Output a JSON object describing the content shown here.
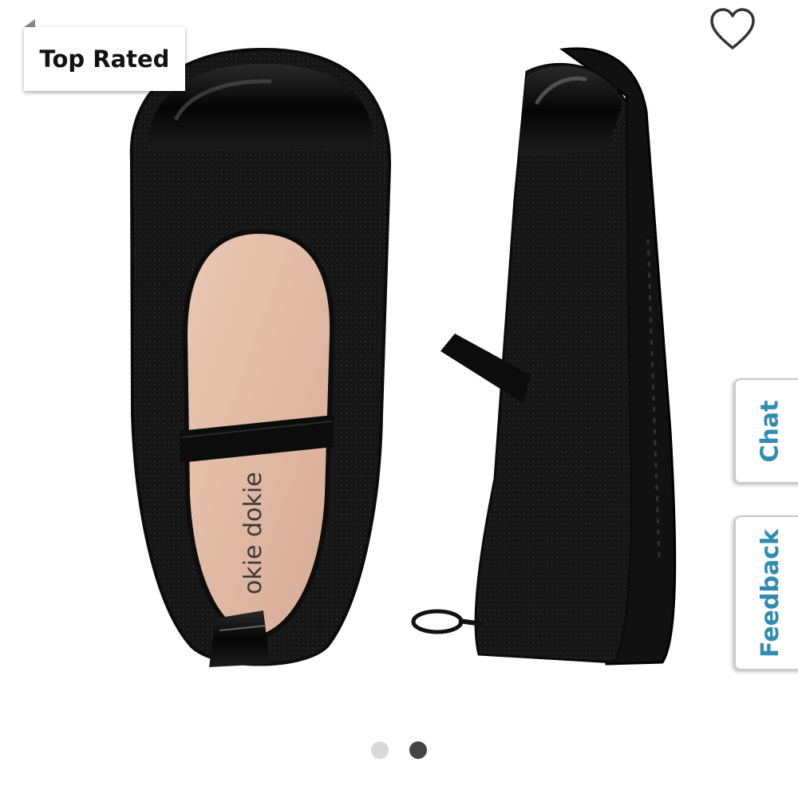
{
  "badge": {
    "label": "Top Rated"
  },
  "favorite": {
    "icon": "heart-outline-icon"
  },
  "side_tabs": [
    {
      "label": "Chat"
    },
    {
      "label": "Feedback"
    }
  ],
  "product": {
    "insole_brand": "okie dokie"
  },
  "carousel": {
    "total": 2,
    "active_index": 2
  },
  "colors": {
    "tab_text": "#2f8cb0",
    "dot_active": "#444444",
    "dot_inactive": "#d8d8d8"
  }
}
